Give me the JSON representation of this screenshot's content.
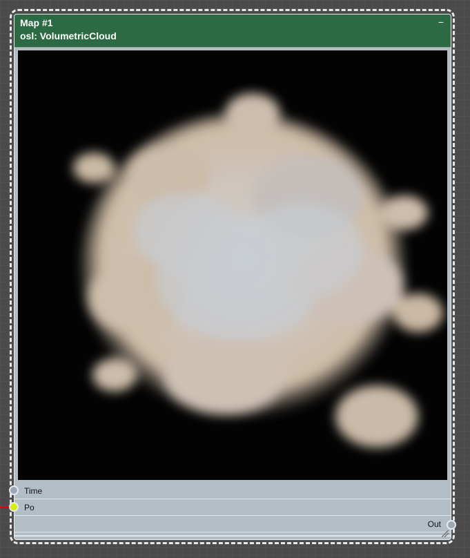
{
  "node": {
    "title": "Map #1",
    "subtitle": "osl: VolumetricCloud",
    "minimize_label": "−"
  },
  "ports": {
    "inputs": [
      {
        "label": "Time"
      },
      {
        "label": "Po"
      }
    ],
    "outputs": [
      {
        "label": "Out"
      }
    ]
  },
  "icons": {
    "minimize": "minimize-icon",
    "resize": "resize-grip-icon",
    "input_socket": "socket-icon",
    "output_socket": "socket-icon"
  },
  "colors": {
    "header": "#2c6a43",
    "body": "#b3bdc6",
    "socket_time": "#9aa8b6",
    "socket_po": "#d7ef10",
    "wire": "#e00000"
  }
}
